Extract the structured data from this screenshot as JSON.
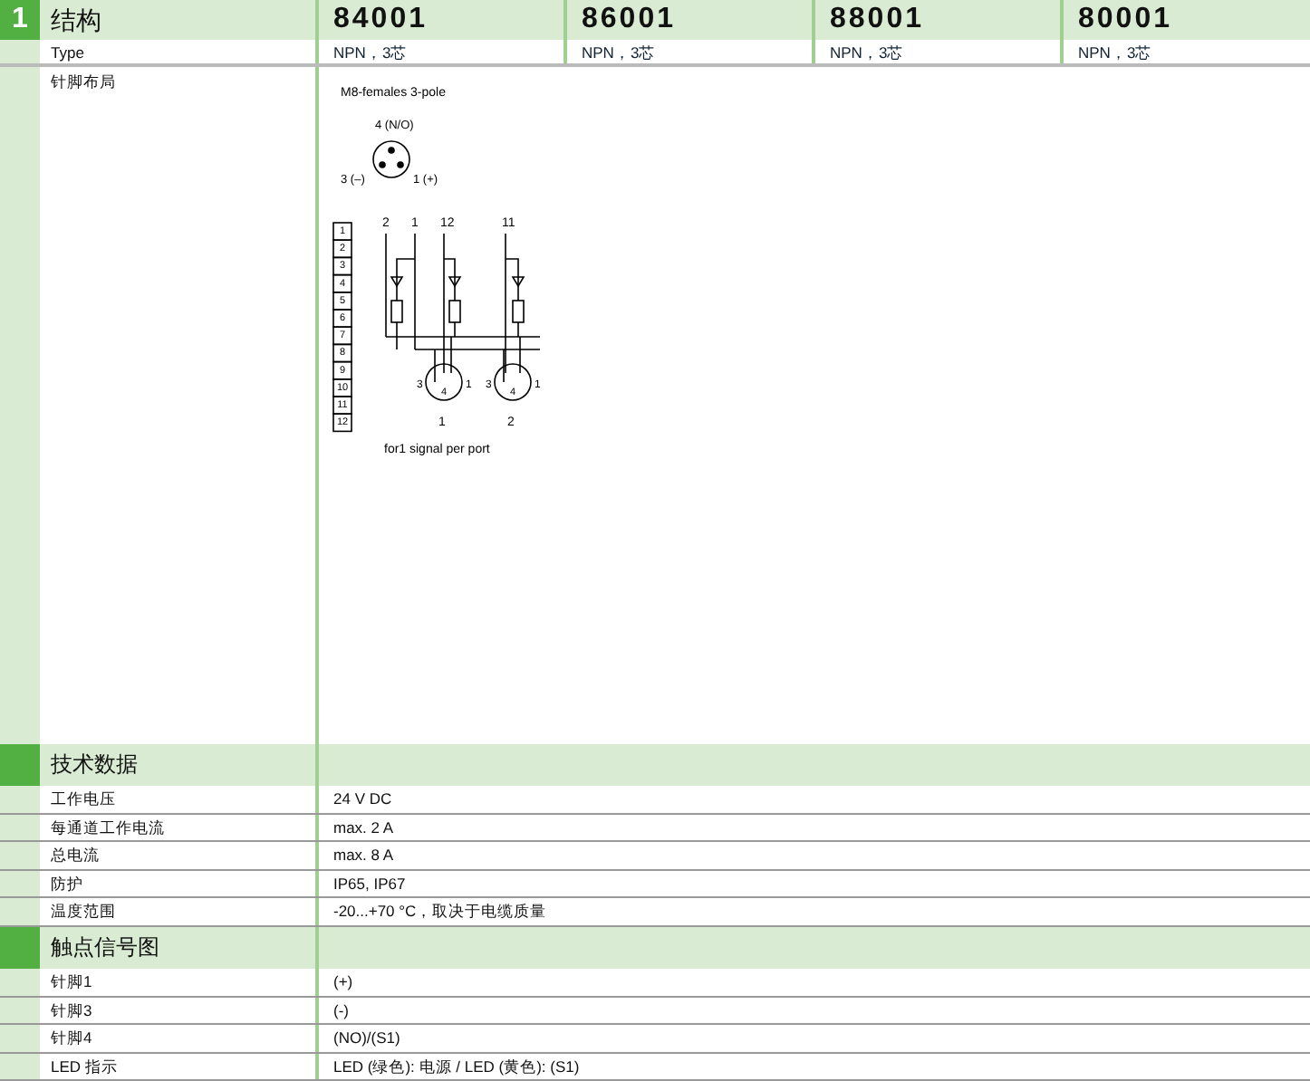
{
  "section_number": "1",
  "header": {
    "label": "结构",
    "models": [
      "84001",
      "86001",
      "88001",
      "80001"
    ]
  },
  "type_row": {
    "label": "Type",
    "values": [
      "NPN，3芯",
      "NPN，3芯",
      "NPN，3芯",
      "NPN，3芯"
    ]
  },
  "pin_layout": {
    "label": "针脚布局",
    "diagram": {
      "title": "M8-females  3-pole",
      "pin_top": "4 (N/O)",
      "pin_left": "3 (–)",
      "pin_right": "1 (+)",
      "wire_labels": [
        "2",
        "1",
        "12",
        "11"
      ],
      "terminals": [
        "1",
        "2",
        "3",
        "4",
        "5",
        "6",
        "7",
        "8",
        "9",
        "10",
        "11",
        "12"
      ],
      "ports": [
        {
          "number": "1",
          "pins": [
            "4",
            "3",
            "1"
          ]
        },
        {
          "number": "2",
          "pins": [
            "4",
            "3",
            "1"
          ]
        }
      ],
      "caption": "for1 signal per port"
    }
  },
  "sections": [
    {
      "title": "技术数据",
      "rows": [
        {
          "label": "工作电压",
          "value": "24 V DC"
        },
        {
          "label": "每通道工作电流",
          "value": "max. 2 A"
        },
        {
          "label": "总电流",
          "value": "max. 8 A"
        },
        {
          "label": "防护",
          "value": "IP65, IP67"
        },
        {
          "label": "温度范围",
          "value": "-20...+70 °C，取决于电缆质量"
        }
      ]
    },
    {
      "title": "触点信号图",
      "rows": [
        {
          "label": "针脚1",
          "value": "(+)"
        },
        {
          "label": "针脚3",
          "value": "(-)"
        },
        {
          "label": "针脚4",
          "value": "(NO)/(S1)"
        },
        {
          "label": "LED 指示",
          "value": "LED (绿色): 电源 / LED (黄色): (S1)"
        }
      ]
    }
  ]
}
